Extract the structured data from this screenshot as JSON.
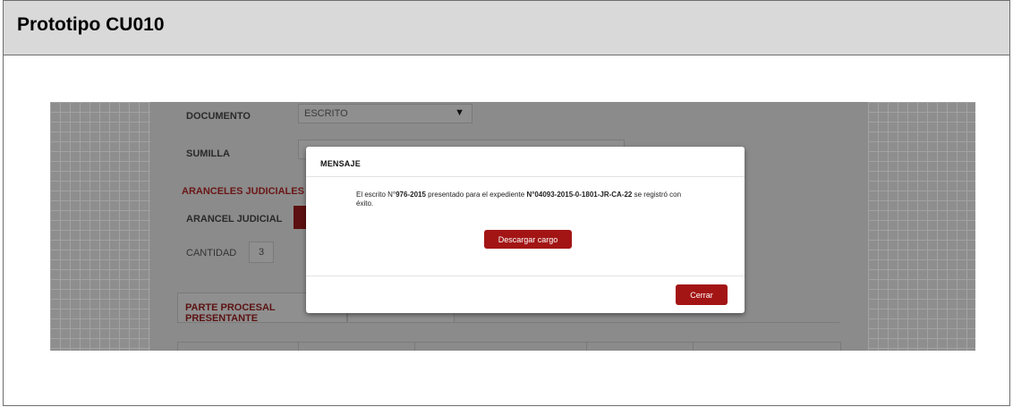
{
  "document": {
    "title": "Prototipo CU010"
  },
  "form": {
    "documento_label": "DOCUMENTO",
    "documento_value": "ESCRITO",
    "sumilla_label": "SUMILLA",
    "aranceles_heading": "ARANCELES JUDICIALES",
    "arancel_label": "ARANCEL JUDICIAL",
    "cantidad_label": "CANTIDAD",
    "cantidad_value": "3",
    "tab_parte": "PARTE PROCESAL PRESENTANTE"
  },
  "modal": {
    "title": "MENSAJE",
    "msg_prefix": "El escrito N°",
    "escrito_number": "976-2015",
    "msg_middle": " presentado para el expediente ",
    "expediente": "N°04093-2015-0-1801-JR-CA-22",
    "msg_suffix": " se registró con éxito.",
    "download_button": "Descargar cargo",
    "close_button": "Cerrar"
  },
  "colors": {
    "accent": "#a31515"
  }
}
